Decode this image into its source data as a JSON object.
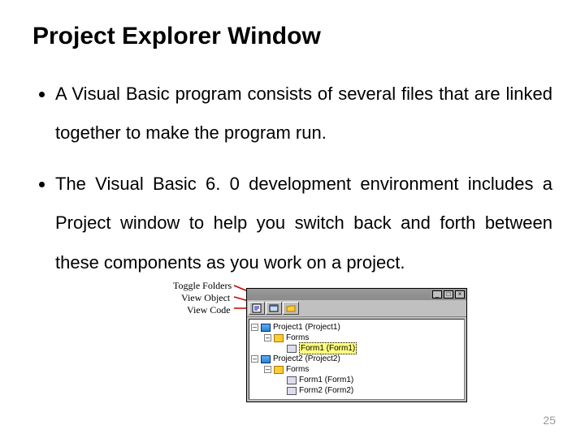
{
  "title": "Project Explorer Window",
  "bullets": [
    "A Visual Basic program consists of several files that are linked together to make the program run.",
    "The Visual Basic 6. 0 development environment includes a Project window to help you switch back and forth between these components as you work on a project."
  ],
  "page_number": "25",
  "labels": {
    "toggle_folders": "Toggle Folders",
    "view_object": "View Object",
    "view_code": "View Code"
  },
  "window": {
    "minimize": "_",
    "maximize": "□",
    "close": "×",
    "toolbar_icons": [
      "view-code-icon",
      "view-object-icon",
      "toggle-folders-icon"
    ],
    "tree": {
      "project1": {
        "exp": "–",
        "label": "Project1 (Project1)",
        "forms": {
          "exp": "–",
          "label": "Forms",
          "items": [
            {
              "label": "Form1 (Form1)",
              "selected": true
            }
          ]
        }
      },
      "project2": {
        "exp": "–",
        "label": "Project2 (Project2)",
        "forms": {
          "exp": "–",
          "label": "Forms",
          "items": [
            {
              "label": "Form1 (Form1)",
              "selected": false
            },
            {
              "label": "Form2 (Form2)",
              "selected": false
            }
          ]
        }
      }
    }
  }
}
